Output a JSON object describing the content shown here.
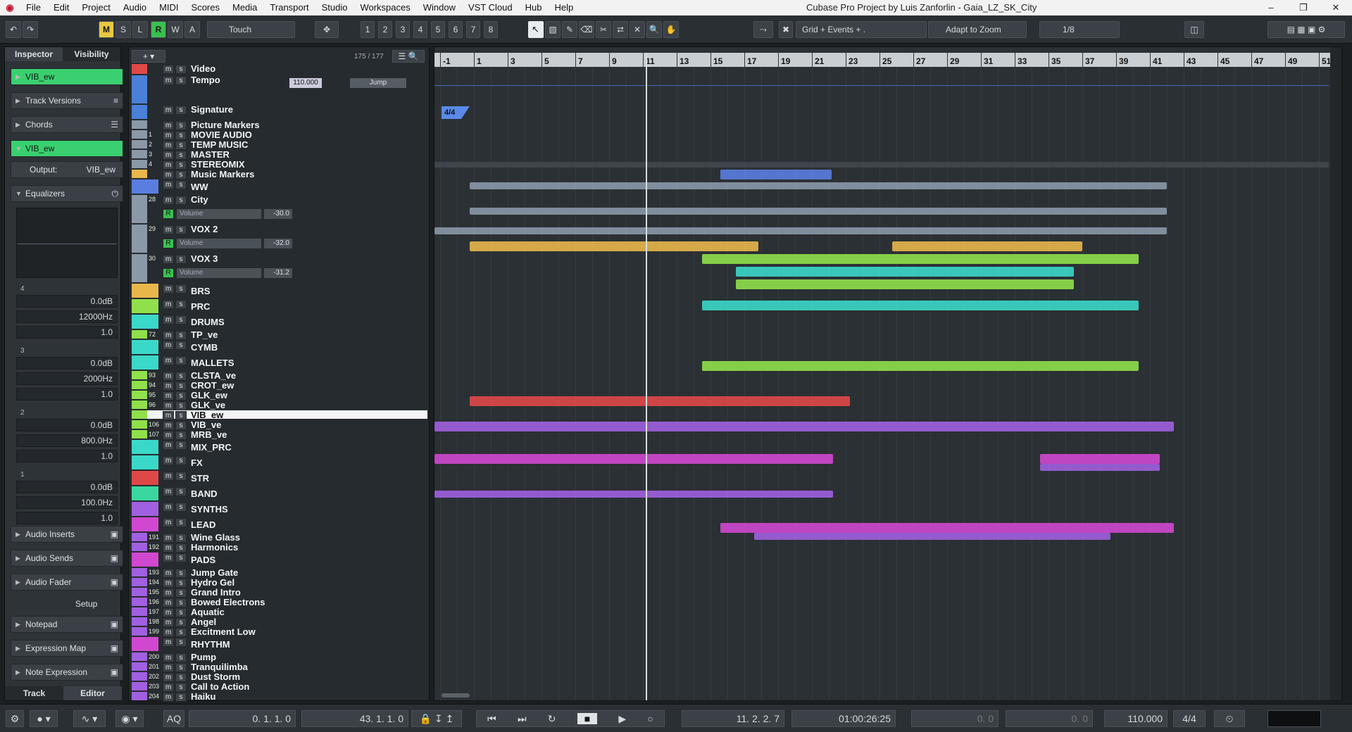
{
  "app": {
    "menu": [
      "File",
      "Edit",
      "Project",
      "Audio",
      "MIDI",
      "Scores",
      "Media",
      "Transport",
      "Studio",
      "Workspaces",
      "Window",
      "VST Cloud",
      "Hub",
      "Help"
    ],
    "title": "Cubase Pro Project by Luis Zanforlin - Gaia_LZ_SK_City"
  },
  "toolbar": {
    "msl": [
      "M",
      "S",
      "L",
      "R",
      "W",
      "A"
    ],
    "automation_mode": "Touch",
    "markers": [
      "1",
      "2",
      "3",
      "4",
      "5",
      "6",
      "7",
      "8"
    ],
    "snap_mode": "Grid + Events + .",
    "zoom_mode": "Adapt to Zoom",
    "quantize": "1/8"
  },
  "inspector": {
    "tabs": [
      "Inspector",
      "Visibility"
    ],
    "track_name": "VIB_ew",
    "sections": [
      "Track Versions",
      "Chords"
    ],
    "instrument": "VIB_ew",
    "output_label": "Output:",
    "output_value": "VIB_ew",
    "equalizers": "Equalizers",
    "eq": [
      {
        "band": "4",
        "gain": "0.0dB",
        "freq": "12000Hz",
        "q": "1.0"
      },
      {
        "band": "3",
        "gain": "0.0dB",
        "freq": "2000Hz",
        "q": "1.0"
      },
      {
        "band": "2",
        "gain": "0.0dB",
        "freq": "800.0Hz",
        "q": "1.0"
      },
      {
        "band": "1",
        "gain": "0.0dB",
        "freq": "100.0Hz",
        "q": "1.0"
      }
    ],
    "lower": [
      "Audio Inserts",
      "Audio Sends",
      "Audio Fader"
    ],
    "setup": "Setup",
    "lower2": [
      "Notepad",
      "Expression Map",
      "Note Expression"
    ],
    "bottom_tabs": [
      "Track",
      "Editor"
    ]
  },
  "tracklist": {
    "count": "175 / 177",
    "tempo_value": "110.000",
    "tempo_jump": "Jump",
    "tracks": [
      {
        "name": "Video",
        "num": "",
        "color": "#e04848",
        "kind": "video"
      },
      {
        "name": "Tempo",
        "num": "",
        "color": "#4a80d8",
        "kind": "tempo"
      },
      {
        "name": "Signature",
        "num": "",
        "color": "#4a80d8",
        "kind": "sig"
      },
      {
        "name": "Picture Markers",
        "num": "",
        "color": "#8a98a8",
        "kind": "marker"
      },
      {
        "name": "MOVIE AUDIO",
        "num": "1",
        "color": "#8a98a8",
        "kind": "audio"
      },
      {
        "name": "TEMP MUSIC",
        "num": "2",
        "color": "#8a98a8",
        "kind": "audio"
      },
      {
        "name": "MASTER",
        "num": "3",
        "color": "#8a98a8",
        "kind": "audio"
      },
      {
        "name": "STEREOMIX",
        "num": "4",
        "color": "#8a98a8",
        "kind": "audio"
      },
      {
        "name": "Music Markers",
        "num": "",
        "color": "#e8b64a",
        "kind": "marker"
      },
      {
        "name": "WW",
        "num": "",
        "color": "#5a7ee0",
        "kind": "folder"
      },
      {
        "name": "City",
        "num": "28",
        "color": "#8a98a8",
        "kind": "audio"
      },
      {
        "name": "VOX 2",
        "num": "29",
        "color": "#8a98a8",
        "kind": "audio"
      },
      {
        "name": "VOX 3",
        "num": "30",
        "color": "#8a98a8",
        "kind": "audio"
      },
      {
        "name": "BRS",
        "num": "",
        "color": "#e8b64a",
        "kind": "folder"
      },
      {
        "name": "PRC",
        "num": "",
        "color": "#8fe04a",
        "kind": "folder"
      },
      {
        "name": "DRUMS",
        "num": "",
        "color": "#3ad8c8",
        "kind": "folder"
      },
      {
        "name": "TP_ve",
        "num": "72",
        "color": "#8fe04a",
        "kind": "inst"
      },
      {
        "name": "CYMB",
        "num": "",
        "color": "#3ad8c8",
        "kind": "folder"
      },
      {
        "name": "MALLETS",
        "num": "",
        "color": "#3ad8c8",
        "kind": "folder"
      },
      {
        "name": "CLSTA_ve",
        "num": "93",
        "color": "#8fe04a",
        "kind": "inst"
      },
      {
        "name": "CROT_ew",
        "num": "94",
        "color": "#8fe04a",
        "kind": "inst"
      },
      {
        "name": "GLK_ew",
        "num": "95",
        "color": "#8fe04a",
        "kind": "inst"
      },
      {
        "name": "GLK_ve",
        "num": "96",
        "color": "#8fe04a",
        "kind": "inst"
      },
      {
        "name": "VIB_ew",
        "num": "97",
        "color": "#8fe04a",
        "kind": "inst"
      },
      {
        "name": "VIB_ve",
        "num": "106",
        "color": "#8fe04a",
        "kind": "inst"
      },
      {
        "name": "MRB_ve",
        "num": "107",
        "color": "#8fe04a",
        "kind": "inst"
      },
      {
        "name": "MIX_PRC",
        "num": "",
        "color": "#3ad8c8",
        "kind": "folder"
      },
      {
        "name": "FX",
        "num": "",
        "color": "#3ad8c8",
        "kind": "folder"
      },
      {
        "name": "STR",
        "num": "",
        "color": "#e04848",
        "kind": "folder"
      },
      {
        "name": "BAND",
        "num": "",
        "color": "#3ad8a0",
        "kind": "folder"
      },
      {
        "name": "SYNTHS",
        "num": "",
        "color": "#a060e0",
        "kind": "folder"
      },
      {
        "name": "LEAD",
        "num": "",
        "color": "#d048d0",
        "kind": "folder"
      },
      {
        "name": "Wine Glass",
        "num": "191",
        "color": "#a060e0",
        "kind": "inst"
      },
      {
        "name": "Harmonics",
        "num": "192",
        "color": "#a060e0",
        "kind": "inst"
      },
      {
        "name": "PADS",
        "num": "",
        "color": "#d048d0",
        "kind": "folder"
      },
      {
        "name": "Jump Gate",
        "num": "193",
        "color": "#a060e0",
        "kind": "inst"
      },
      {
        "name": "Hydro Gel",
        "num": "194",
        "color": "#a060e0",
        "kind": "inst"
      },
      {
        "name": "Grand Intro",
        "num": "195",
        "color": "#a060e0",
        "kind": "inst"
      },
      {
        "name": "Bowed Electrons",
        "num": "196",
        "color": "#a060e0",
        "kind": "inst"
      },
      {
        "name": "Aquatic",
        "num": "197",
        "color": "#a060e0",
        "kind": "inst"
      },
      {
        "name": "Angel",
        "num": "198",
        "color": "#a060e0",
        "kind": "inst"
      },
      {
        "name": "Excitment Low",
        "num": "199",
        "color": "#a060e0",
        "kind": "inst"
      },
      {
        "name": "RHYTHM",
        "num": "",
        "color": "#d048d0",
        "kind": "folder"
      },
      {
        "name": "Pump",
        "num": "200",
        "color": "#a060e0",
        "kind": "inst"
      },
      {
        "name": "Tranquilimba",
        "num": "201",
        "color": "#a060e0",
        "kind": "inst"
      },
      {
        "name": "Dust Storm",
        "num": "202",
        "color": "#a060e0",
        "kind": "inst"
      },
      {
        "name": "Call to Action",
        "num": "203",
        "color": "#a060e0",
        "kind": "inst"
      },
      {
        "name": "Haiku",
        "num": "204",
        "color": "#a060e0",
        "kind": "inst"
      }
    ],
    "lanes": {
      "volume_label": "Volume",
      "city_volume": "-30.0",
      "vox2_volume": "-32.0",
      "vox3_volume": "-31.2"
    }
  },
  "ruler": {
    "ticks": [
      "-1",
      "1",
      "3",
      "5",
      "7",
      "9",
      "11",
      "13",
      "15",
      "17",
      "19",
      "21",
      "23",
      "25",
      "27",
      "29",
      "31",
      "33",
      "35",
      "37",
      "39",
      "41",
      "43",
      "45",
      "47",
      "49",
      "51"
    ]
  },
  "signature_event": "4/4",
  "transport": {
    "left_locator": "0. 1. 1.   0",
    "right_locator": "43. 1. 1.   0",
    "aq": "AQ",
    "position": "11. 2. 2.   7",
    "timecode": "01:00:26:25",
    "punch_in": "0.    0",
    "punch_out": "0.    0",
    "tempo": "110.000",
    "signature": "4/4"
  }
}
